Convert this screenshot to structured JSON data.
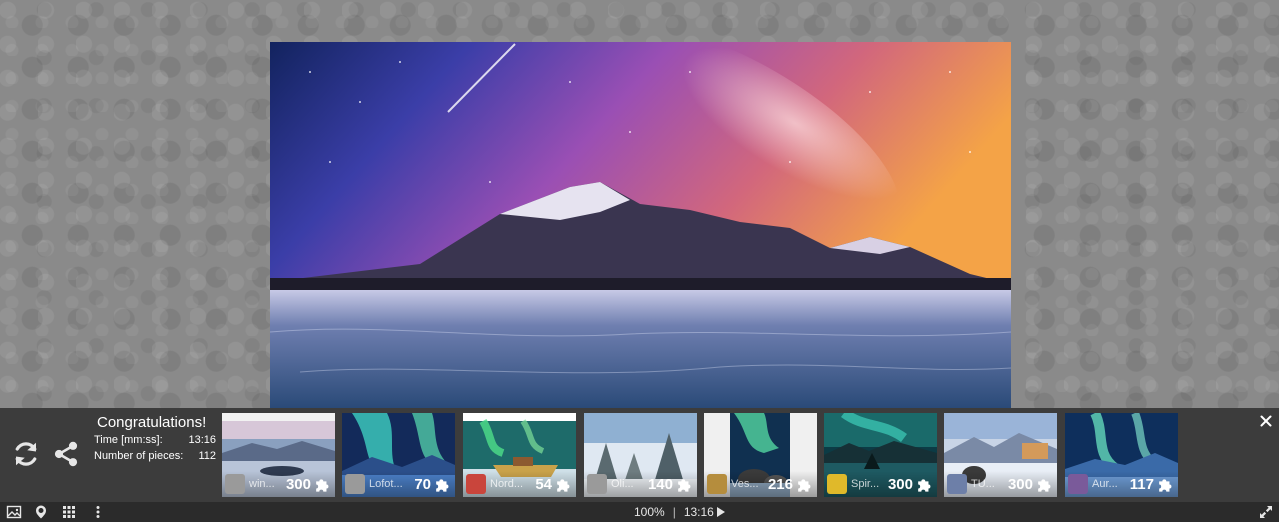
{
  "congrats": {
    "title": "Congratulations!",
    "time_label": "Time [mm:ss]:",
    "time_value": "13:16",
    "pieces_label": "Number of pieces:",
    "pieces_value": "112"
  },
  "puzzles": [
    {
      "name": "win...",
      "pieces": "300",
      "avatar": "#9a9a9a",
      "scene": "winter-lake"
    },
    {
      "name": "Lofot...",
      "pieces": "70",
      "avatar": "#9a9a9a",
      "scene": "aurora"
    },
    {
      "name": "Nord...",
      "pieces": "54",
      "avatar": "#c9453c",
      "scene": "boat"
    },
    {
      "name": "Oli...",
      "pieces": "140",
      "avatar": "#9a9a9a",
      "scene": "snowy-forest"
    },
    {
      "name": "Ves...",
      "pieces": "216",
      "avatar": "#b58d3d",
      "scene": "aurora-rocks"
    },
    {
      "name": "Spir...",
      "pieces": "300",
      "avatar": "#e0b92a",
      "scene": "teal-lake"
    },
    {
      "name": "TU...",
      "pieces": "300",
      "avatar": "#6d7fa8",
      "scene": "snow-village"
    },
    {
      "name": "Aur...",
      "pieces": "117",
      "avatar": "#7a5a9a",
      "scene": "aurora-blue"
    }
  ],
  "status": {
    "zoom": "100%",
    "timer": "13:16"
  },
  "colors": {
    "panel": "#3c3c3c",
    "statusbar": "#2b2b2b",
    "background": "#8a8a8a"
  }
}
